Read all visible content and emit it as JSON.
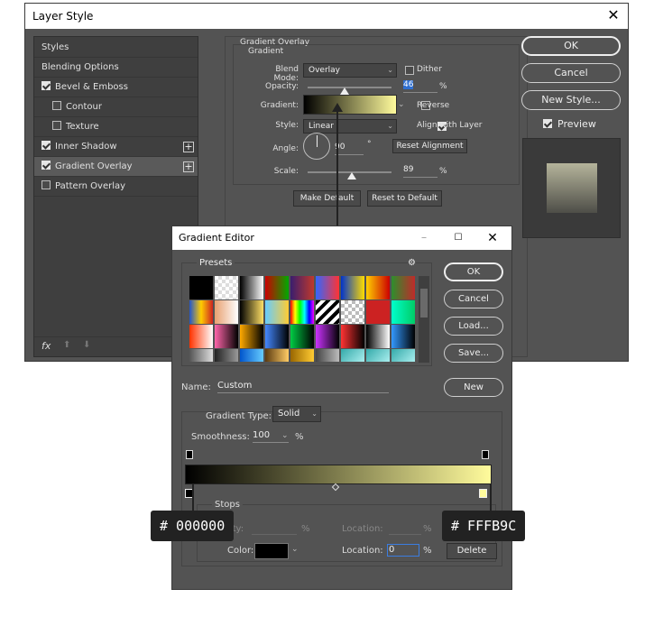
{
  "layer_style": {
    "title": "Layer Style",
    "sidebar": [
      {
        "label": "Styles",
        "checkbox": false
      },
      {
        "label": "Blending Options",
        "checkbox": false
      },
      {
        "label": "Bevel & Emboss",
        "checkbox": true,
        "checked": true
      },
      {
        "label": "Contour",
        "checkbox": true,
        "checked": false
      },
      {
        "label": "Texture",
        "checkbox": true,
        "checked": false
      },
      {
        "label": "Inner Shadow",
        "checkbox": true,
        "checked": true
      },
      {
        "label": "Gradient Overlay",
        "checkbox": true,
        "checked": true
      },
      {
        "label": "Pattern Overlay",
        "checkbox": true,
        "checked": false
      }
    ],
    "footer_fx": "fx",
    "panel": {
      "group_title": "Gradient Overlay",
      "sub_title": "Gradient",
      "blend_mode_label": "Blend Mode:",
      "blend_mode_value": "Overlay",
      "dither_label": "Dither",
      "opacity_label": "Opacity:",
      "opacity_value": "46",
      "percent": "%",
      "gradient_label": "Gradient:",
      "reverse_label": "Reverse",
      "style_label": "Style:",
      "style_value": "Linear",
      "align_label": "Align with Layer",
      "angle_label": "Angle:",
      "angle_value": "90",
      "degree": "°",
      "reset_alignment": "Reset Alignment",
      "scale_label": "Scale:",
      "scale_value": "89",
      "make_default": "Make Default",
      "reset_default": "Reset to Default"
    },
    "buttons": {
      "ok": "OK",
      "cancel": "Cancel",
      "new_style": "New Style...",
      "preview": "Preview"
    }
  },
  "gradient_editor": {
    "title": "Gradient Editor",
    "presets_label": "Presets",
    "buttons": {
      "ok": "OK",
      "cancel": "Cancel",
      "load": "Load...",
      "save": "Save...",
      "new": "New",
      "delete": "Delete"
    },
    "name_label": "Name:",
    "name_value": "Custom",
    "gradient_type_label": "Gradient Type:",
    "gradient_type_value": "Solid",
    "smoothness_label": "Smoothness:",
    "smoothness_value": "100",
    "percent": "%",
    "stops_label": "Stops",
    "opacity_label": "Opacity:",
    "location_label": "Location:",
    "color_label": "Color:",
    "color_location_value": "0"
  },
  "callouts": {
    "left": "# 000000",
    "right": "# FFFB9C"
  },
  "colors": {
    "start": "#000000",
    "end": "#FFFB9C"
  },
  "presets": [
    "linear-gradient(135deg,#000,#000)",
    "repeating-conic-gradient(#ddd 0 25%,#fff 0 50%)",
    "linear-gradient(90deg,#000,#fff)",
    "linear-gradient(90deg,#c00,#0a0)",
    "linear-gradient(90deg,#3a1d6e,#c0392b)",
    "linear-gradient(90deg,#3366ff,#ff3333)",
    "linear-gradient(90deg,#0033cc,#ffdd00)",
    "linear-gradient(90deg,#ffd000,#cc0000)",
    "linear-gradient(90deg,#2d8f2d,#c02a2a)",
    "linear-gradient(90deg,#2255cc,#ffcc00,#cc2222)",
    "linear-gradient(90deg,#e8a070,#fff)",
    "linear-gradient(90deg,#000,#ffe066)",
    "linear-gradient(90deg,#66ccff,#ffcc33)",
    "linear-gradient(90deg,#ff0000,#ffff00,#00ff00,#00ffff,#0000ff,#ff00ff)",
    "repeating-linear-gradient(135deg,#000 0 4px,#fff 4px 8px)",
    "repeating-conic-gradient(#bbb 0 25%,#fff 0 50%)",
    "linear-gradient(90deg,#cc2222,#cc2222)",
    "linear-gradient(90deg,#00ffcc,#00cc66)",
    "linear-gradient(90deg,#ff3300,#fff)",
    "linear-gradient(90deg,#ff66aa,#000)",
    "linear-gradient(90deg,#ffaa00,#000)",
    "linear-gradient(90deg,#4488ff,#000)",
    "linear-gradient(90deg,#00cc44,#000)",
    "linear-gradient(90deg,#cc33ff,#000)",
    "linear-gradient(90deg,#ff3333,#000)",
    "linear-gradient(90deg,#000,#fff)",
    "linear-gradient(90deg,#3399ff,#000)",
    "linear-gradient(90deg,#555,#ddd)",
    "linear-gradient(90deg,#222,#999)",
    "linear-gradient(90deg,#0055cc,#66ccff)",
    "linear-gradient(90deg,#5a3a10,#ffcc66)",
    "linear-gradient(90deg,#996600,#ffcc33)",
    "linear-gradient(90deg,#444,#bbb)",
    "linear-gradient(135deg,#33aaaa,#aaeeee)",
    "linear-gradient(135deg,#33aaaa,#aaeeee)",
    "linear-gradient(135deg,#33aaaa,#aaeeee)"
  ]
}
